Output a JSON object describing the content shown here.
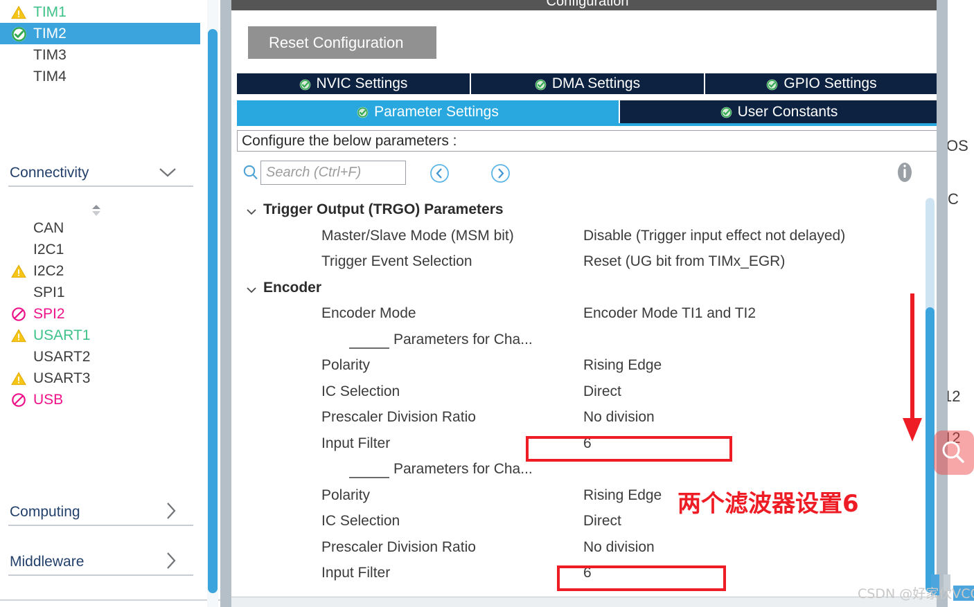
{
  "sidebar": {
    "timers": [
      {
        "label": "TIM1",
        "status": "warning",
        "color": "green",
        "selected": false
      },
      {
        "label": "TIM2",
        "status": "ok",
        "color": "white",
        "selected": true
      },
      {
        "label": "TIM3",
        "status": "none",
        "color": "dark",
        "selected": false
      },
      {
        "label": "TIM4",
        "status": "none",
        "color": "dark",
        "selected": false
      }
    ],
    "connectivity": {
      "label": "Connectivity",
      "chevron": "chevron-down-icon",
      "items": [
        {
          "label": "CAN",
          "status": "none",
          "color": "dark"
        },
        {
          "label": "I2C1",
          "status": "none",
          "color": "dark"
        },
        {
          "label": "I2C2",
          "status": "warning",
          "color": "dark"
        },
        {
          "label": "SPI1",
          "status": "none",
          "color": "dark"
        },
        {
          "label": "SPI2",
          "status": "disabled",
          "color": "pink"
        },
        {
          "label": "USART1",
          "status": "warning",
          "color": "green"
        },
        {
          "label": "USART2",
          "status": "none",
          "color": "dark"
        },
        {
          "label": "USART3",
          "status": "warning",
          "color": "dark"
        },
        {
          "label": "USB",
          "status": "disabled",
          "color": "pink"
        }
      ]
    },
    "computing": {
      "label": "Computing",
      "chevron": "chevron-right-icon"
    },
    "middleware": {
      "label": "Middleware",
      "chevron": "chevron-right-icon"
    }
  },
  "panel": {
    "title": "Configuration",
    "reset_button": "Reset Configuration",
    "tabs_row1": [
      {
        "label": "NVIC Settings",
        "checked": true,
        "active": false
      },
      {
        "label": "DMA Settings",
        "checked": true,
        "active": false
      },
      {
        "label": "GPIO Settings",
        "checked": true,
        "active": false
      }
    ],
    "tabs_row2": [
      {
        "label": "Parameter Settings",
        "checked": true,
        "active": true
      },
      {
        "label": "User Constants",
        "checked": true,
        "active": false
      }
    ],
    "configure_label": "Configure the below parameters :",
    "search": {
      "placeholder": "Search (Ctrl+F)",
      "value": "",
      "icon": "search-icon",
      "prev_icon": "chevron-left-circle-icon",
      "next_icon": "chevron-right-circle-icon",
      "info_icon": "info-icon"
    },
    "parameters": [
      {
        "kind": "group",
        "label": "Trigger Output (TRGO) Parameters",
        "expanded": true
      },
      {
        "kind": "param",
        "name": "Master/Slave Mode (MSM bit)",
        "value": "Disable (Trigger input effect not delayed)"
      },
      {
        "kind": "param",
        "name": "Trigger Event Selection",
        "value": "Reset (UG bit from TIMx_EGR)"
      },
      {
        "kind": "group",
        "label": "Encoder",
        "expanded": true
      },
      {
        "kind": "param",
        "name": "Encoder Mode",
        "value": "Encoder Mode TI1 and TI2"
      },
      {
        "kind": "subheader",
        "name": "Parameters for Cha..."
      },
      {
        "kind": "param",
        "name": "Polarity",
        "value": "Rising Edge"
      },
      {
        "kind": "param",
        "name": "IC Selection",
        "value": "Direct"
      },
      {
        "kind": "param",
        "name": "Prescaler Division Ratio",
        "value": "No division"
      },
      {
        "kind": "param",
        "name": "Input Filter",
        "value": "6",
        "highlighted": true
      },
      {
        "kind": "subheader",
        "name": "Parameters for Cha..."
      },
      {
        "kind": "param",
        "name": "Polarity",
        "value": "Rising Edge"
      },
      {
        "kind": "param",
        "name": "IC Selection",
        "value": "Direct"
      },
      {
        "kind": "param",
        "name": "Prescaler Division Ratio",
        "value": "No division"
      },
      {
        "kind": "param",
        "name": "Input Filter",
        "value": "6",
        "highlighted": true
      }
    ]
  },
  "annotations": {
    "note_text": "两个滤波器设置6",
    "note_color": "#ee1c25",
    "arrow": "down-arrow-icon",
    "arrow_color": "#ee1c25"
  },
  "right_edge": {
    "fragment_1": "OS",
    "fragment_2": "C",
    "fragment_3": "12",
    "fragment_4": "12"
  },
  "floating": {
    "magnifier_icon": "magnifier-icon"
  },
  "watermark": {
    "text": "CSDN @好家伙VCC"
  }
}
